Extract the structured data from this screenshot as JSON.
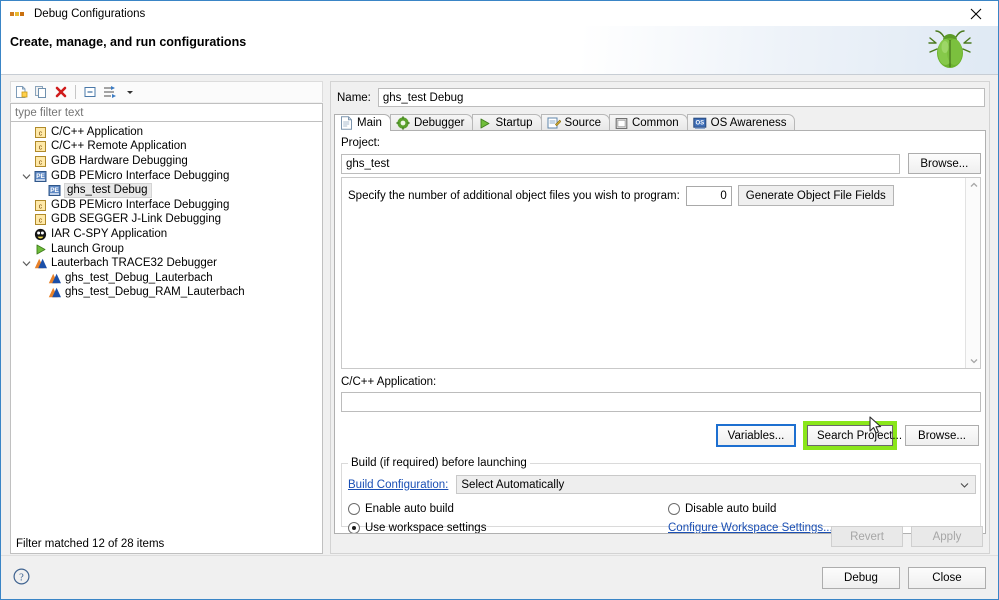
{
  "window": {
    "title": "Debug Configurations",
    "close_label": "Close window",
    "banner_title": "Create, manage, and run configurations",
    "mascot_icon": "green-bug-icon"
  },
  "toolbar": {
    "buttons": [
      {
        "name": "new-launch-configuration",
        "icon": "new-document-icon"
      },
      {
        "name": "duplicate-configuration",
        "icon": "copy-icon"
      },
      {
        "name": "delete-configuration",
        "icon": "delete-red-x-icon"
      },
      {
        "name": "collapse-all",
        "icon": "collapse-all-icon"
      },
      {
        "name": "filter-configurations",
        "icon": "filter-icon"
      },
      {
        "name": "toolbar-menu",
        "icon": "chevron-down-icon"
      }
    ]
  },
  "filter": {
    "placeholder": "type filter text",
    "value": "",
    "status": "Filter matched 12 of 28 items"
  },
  "tree": {
    "items": [
      {
        "label": "C/C++ Application",
        "icon": "c-file-icon",
        "indent": 1,
        "twisty": "none",
        "selected": false
      },
      {
        "label": "C/C++ Remote Application",
        "icon": "c-file-icon",
        "indent": 1,
        "twisty": "none",
        "selected": false
      },
      {
        "label": "GDB Hardware Debugging",
        "icon": "c-file-icon",
        "indent": 1,
        "twisty": "none",
        "selected": false
      },
      {
        "label": "GDB PEMicro Interface Debugging",
        "icon": "pemicro-icon",
        "indent": 1,
        "twisty": "expanded",
        "selected": false
      },
      {
        "label": "ghs_test Debug",
        "icon": "pemicro-icon",
        "indent": 2,
        "twisty": "none",
        "selected": true
      },
      {
        "label": "GDB PEMicro Interface Debugging",
        "icon": "c-file-icon",
        "indent": 1,
        "twisty": "none",
        "selected": false
      },
      {
        "label": "GDB SEGGER J-Link Debugging",
        "icon": "c-file-icon",
        "indent": 1,
        "twisty": "none",
        "selected": false
      },
      {
        "label": "IAR C-SPY Application",
        "icon": "iar-black-circle-icon",
        "indent": 1,
        "twisty": "none",
        "selected": false
      },
      {
        "label": "Launch Group",
        "icon": "green-play-icon",
        "indent": 1,
        "twisty": "none",
        "selected": false
      },
      {
        "label": "Lauterbach TRACE32 Debugger",
        "icon": "lauterbach-triangle-icon",
        "indent": 1,
        "twisty": "expanded",
        "selected": false
      },
      {
        "label": "ghs_test_Debug_Lauterbach",
        "icon": "lauterbach-triangle-icon",
        "indent": 2,
        "twisty": "none",
        "selected": false
      },
      {
        "label": "ghs_test_Debug_RAM_Lauterbach",
        "icon": "lauterbach-triangle-icon",
        "indent": 2,
        "twisty": "none",
        "selected": false
      }
    ]
  },
  "config": {
    "name_label": "Name:",
    "name_value": "ghs_test Debug",
    "tabs": [
      {
        "label": "Main",
        "icon": "document-page-icon",
        "active": true
      },
      {
        "label": "Debugger",
        "icon": "gear-green-icon",
        "active": false
      },
      {
        "label": "Startup",
        "icon": "green-play-icon",
        "active": false
      },
      {
        "label": "Source",
        "icon": "source-folder-icon",
        "active": false
      },
      {
        "label": "Common",
        "icon": "window-square-icon",
        "active": false
      },
      {
        "label": "OS Awareness",
        "icon": "os-blue-icon",
        "active": false
      }
    ],
    "main": {
      "project_label": "Project:",
      "project_value": "ghs_test",
      "project_browse_label": "Browse...",
      "object_files_label": "Specify the number of additional object files you wish to program:",
      "object_files_value": "0",
      "generate_button_label": "Generate Object File Fields",
      "application_label": "C/C++ Application:",
      "application_value": "",
      "variables_button_label": "Variables...",
      "search_project_button_label": "Search Project...",
      "app_browse_button_label": "Browse...",
      "highlight_color": "#8ae61a",
      "focus_color": "#1d6fd0",
      "build_group_title": "Build (if required) before launching",
      "build_configuration_link": "Build Configuration:",
      "build_configuration_value": "Select Automatically",
      "radio_enable_auto_build": "Enable auto build",
      "radio_disable_auto_build": "Disable auto build",
      "radio_use_workspace_settings": "Use workspace settings",
      "configure_workspace_link": "Configure Workspace Settings...",
      "selected_radio": "use_workspace_settings"
    },
    "revert_label": "Revert",
    "apply_label": "Apply"
  },
  "footer": {
    "help_icon": "question-mark-help-icon",
    "debug_label": "Debug",
    "close_label": "Close"
  }
}
